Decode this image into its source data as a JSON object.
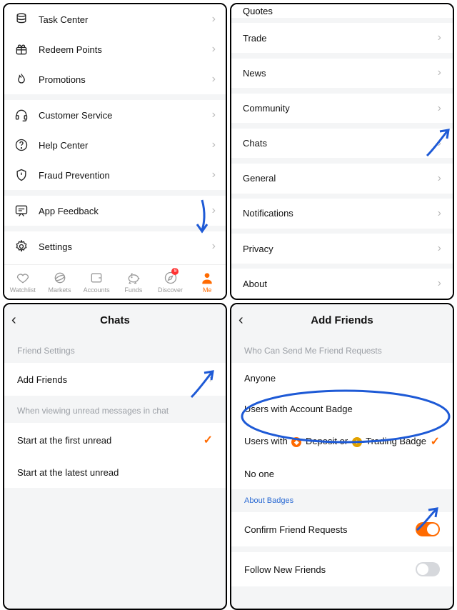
{
  "panel1": {
    "menu": [
      {
        "label": "Task Center",
        "icon": "stack"
      },
      {
        "label": "Redeem Points",
        "icon": "gift"
      },
      {
        "label": "Promotions",
        "icon": "flame"
      }
    ],
    "menu2": [
      {
        "label": "Customer Service",
        "icon": "headset"
      },
      {
        "label": "Help Center",
        "icon": "question"
      },
      {
        "label": "Fraud Prevention",
        "icon": "shield"
      }
    ],
    "menu3": [
      {
        "label": "App Feedback",
        "icon": "feedback"
      }
    ],
    "menu4": [
      {
        "label": "Settings",
        "icon": "gear"
      }
    ],
    "tabs": [
      {
        "label": "Watchlist",
        "icon": "heart"
      },
      {
        "label": "Markets",
        "icon": "planet"
      },
      {
        "label": "Accounts",
        "icon": "wallet"
      },
      {
        "label": "Funds",
        "icon": "piggy"
      },
      {
        "label": "Discover",
        "icon": "compass",
        "badge": "9"
      },
      {
        "label": "Me",
        "icon": "person",
        "active": true
      }
    ]
  },
  "panel2": {
    "items": [
      "Quotes",
      "Trade",
      "News",
      "Community",
      "Chats",
      "General",
      "Notifications",
      "Privacy",
      "About"
    ]
  },
  "panel3": {
    "title": "Chats",
    "section1": "Friend Settings",
    "addFriends": "Add Friends",
    "section2": "When viewing unread messages in chat",
    "opt1": "Start at the first unread",
    "opt2": "Start at the latest unread"
  },
  "panel4": {
    "title": "Add Friends",
    "section1": "Who Can Send Me Friend Requests",
    "opt_anyone": "Anyone",
    "opt_account": "Users with Account Badge",
    "opt_deposit_prefix": "Users with",
    "opt_deposit_mid": "Deposit or",
    "opt_deposit_suffix": "Trading Badge",
    "opt_noone": "No one",
    "about_badges": "About Badges",
    "confirm": "Confirm Friend Requests",
    "follow": "Follow New Friends"
  }
}
